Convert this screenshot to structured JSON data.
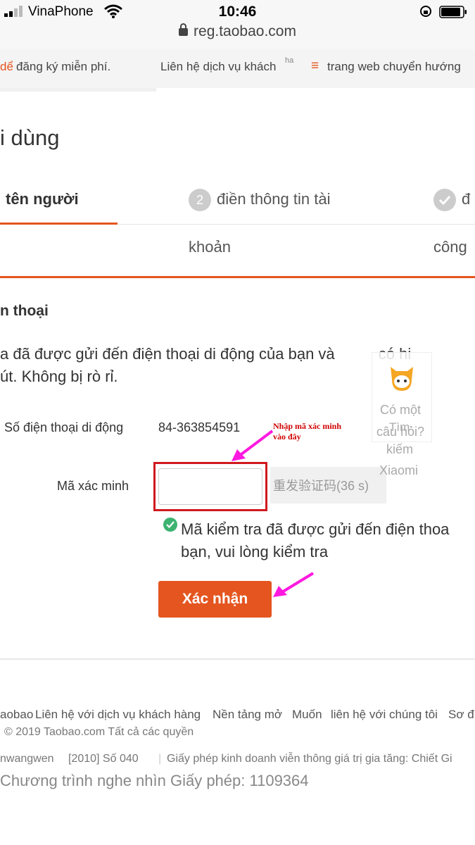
{
  "status": {
    "carrier": "VinaPhone",
    "time": "10:46",
    "url": "reg.taobao.com"
  },
  "topnav": {
    "left_partial": "dể",
    "register": "đăng ký miễn phí.",
    "contact": "Liên hệ dịch vụ khách",
    "contact_cut": "ha",
    "redirect": "trang web chuyển hướng"
  },
  "page": {
    "title": "i dùng"
  },
  "steps": [
    {
      "line1": "tên người",
      "line2": ""
    },
    {
      "number": "2",
      "line1": "điền thông tin tài",
      "line2": "khoản"
    },
    {
      "line1": "đ",
      "line2": "công"
    }
  ],
  "verify": {
    "section_title": "n thoại",
    "message_line1": "a đã được gửi đến điện thoại di động của bạn và ",
    "message_line1_end": "có hi",
    "message_line2": "út. Không bị rò rỉ.",
    "phone_label": "Số điện thoại di động",
    "phone_value": "84-363854591",
    "code_label": "Mã xác minh",
    "code_value": "",
    "resend_label": "重发验证码(36 s)",
    "sent_line1": "Mã kiểm tra đã được gửi đến điện thoa",
    "sent_line2": "bạn, vui lòng kiểm tra",
    "confirm_label": "Xác nhận"
  },
  "annotation": {
    "note": "Nhập mã xác minh vào đây",
    "box_color": "#d0191f",
    "arrow_color": "#ff19e0"
  },
  "help": {
    "line1": "Có một",
    "line2": "câu hỏi?",
    "overlay1": "Tìm",
    "overlay2": "kiếm",
    "overlay3": "Xiaomi"
  },
  "footer": {
    "links": [
      "aobao",
      "Liên hệ với dịch vụ khách hàng",
      "Nền tảng mở",
      "Muốn",
      "liên hệ với chúng tôi",
      "Sơ đ"
    ],
    "copyright": "© 2019 Taobao.com Tất cả các quyền",
    "lic1": "nwangwen",
    "lic2": "[2010] Số 040",
    "lic3": "Giấy phép kinh doanh viễn thông giá trị gia tăng: Chiết Gi",
    "license": "Chương trình nghe nhìn Giấy phép: 1109364"
  },
  "colors": {
    "accent": "#e4551f",
    "success": "#3cb371"
  }
}
